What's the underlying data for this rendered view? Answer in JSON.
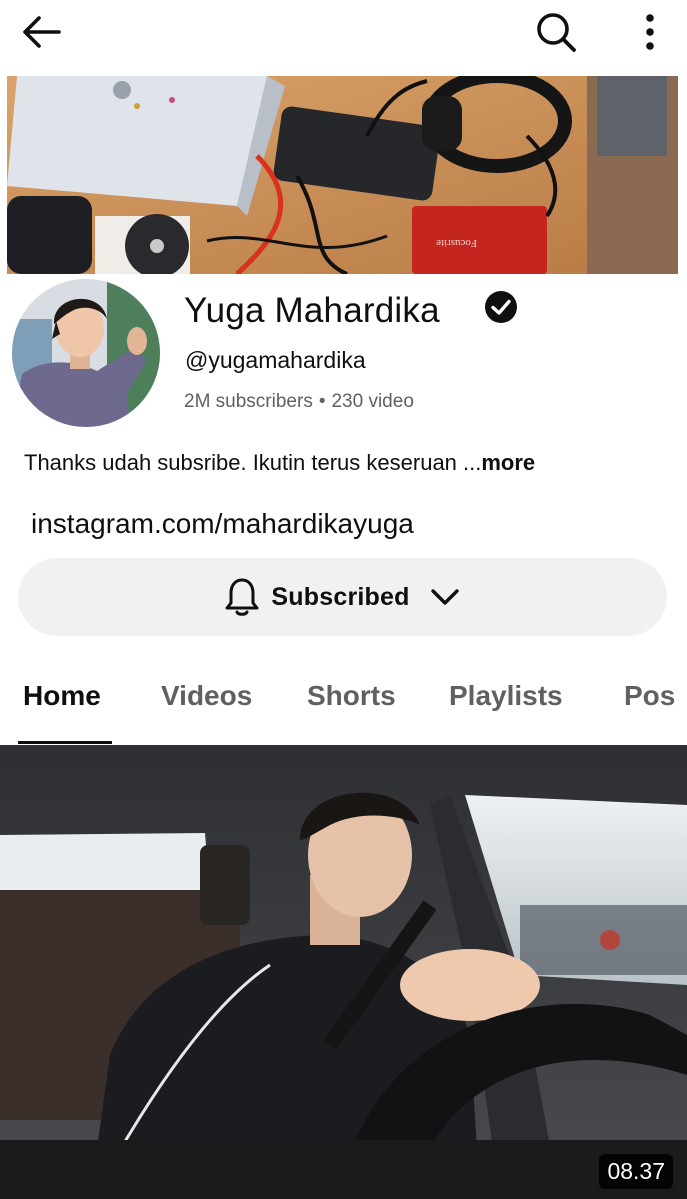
{
  "toolbar": {
    "back_icon": "arrow-left-icon",
    "search_icon": "search-icon",
    "more_icon": "more-vertical-icon"
  },
  "channel": {
    "name": "Yuga Mahardika",
    "verified_icon": "verified-check-icon",
    "handle": "@yugamahardika",
    "subscribers": "2M subscribers",
    "separator": "•",
    "video_count": "230 video",
    "description": "Thanks udah subsribe. Ikutin terus keseruan ...",
    "description_more": "more",
    "link": "instagram.com/mahardikayuga"
  },
  "subscribe": {
    "label": "Subscribed",
    "bell_icon": "bell-icon",
    "chevron_icon": "chevron-down-icon"
  },
  "tabs": [
    {
      "label": "Home",
      "active": true
    },
    {
      "label": "Videos",
      "active": false
    },
    {
      "label": "Shorts",
      "active": false
    },
    {
      "label": "Playlists",
      "active": false
    },
    {
      "label": "Pos",
      "active": false
    }
  ],
  "video": {
    "duration": "08.37"
  },
  "colors": {
    "text_primary": "#0f0f0f",
    "text_secondary": "#606060",
    "button_bg": "#f1f1f1"
  }
}
